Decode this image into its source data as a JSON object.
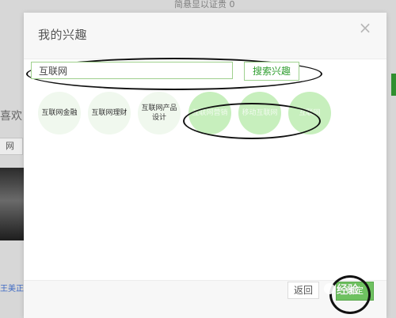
{
  "background": {
    "top_counter": "简悬显以证贵 0",
    "left_label": "喜欢",
    "left_chip": "网络",
    "bottom_link": "王美正元"
  },
  "modal": {
    "title": "我的兴趣",
    "close_icon": "×",
    "search": {
      "value": "互联网",
      "button_label": "搜索兴趣"
    },
    "tags": [
      {
        "label": "互联网金融",
        "selected": false
      },
      {
        "label": "互联网理财",
        "selected": false
      },
      {
        "label": "互联网产品设计",
        "selected": false
      },
      {
        "label": "互联网营销",
        "selected": true
      },
      {
        "label": "移动互联网",
        "selected": true
      },
      {
        "label": "互联网",
        "selected": true
      }
    ],
    "footer": {
      "return_label": "返回",
      "confirm_label": "确定"
    }
  },
  "watermark": {
    "text": "经验"
  },
  "colors": {
    "accent_green": "#6ec160",
    "input_border_green": "#9fd08d",
    "selected_bubble": "#c7efbd",
    "unselected_bubble": "#f0f8ee"
  },
  "icons": {
    "close": "close-icon",
    "watermark": "watermark-icon"
  }
}
